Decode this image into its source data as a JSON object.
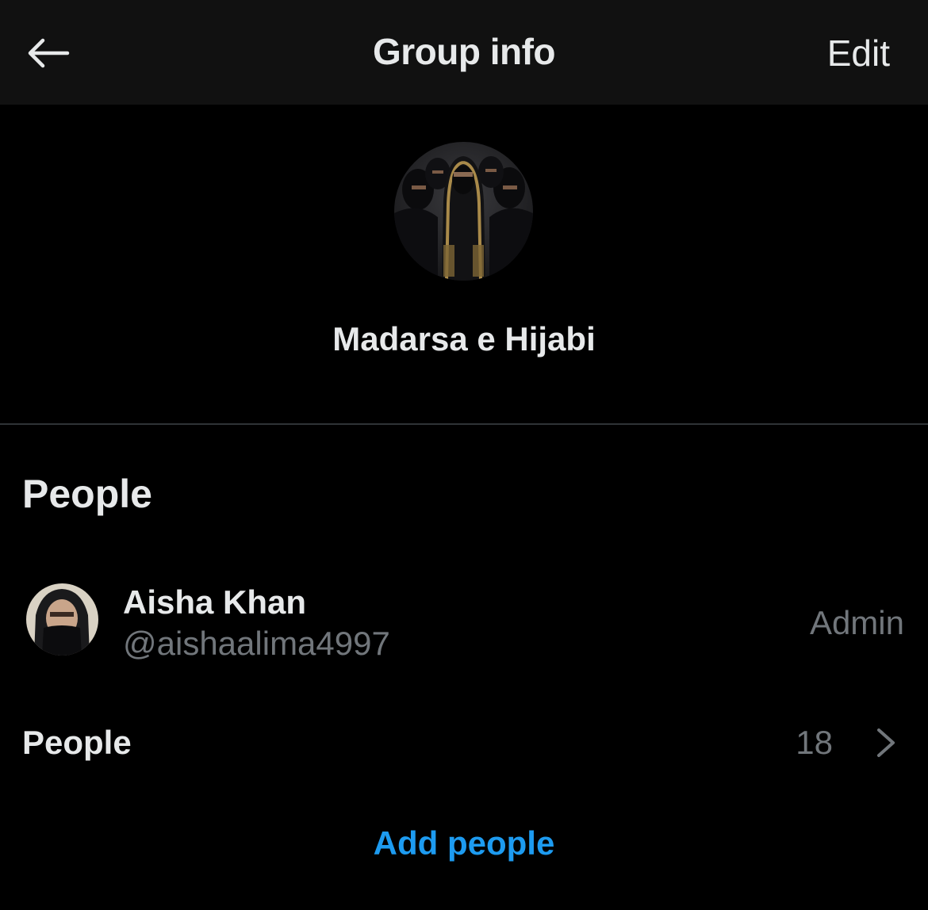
{
  "header": {
    "back_icon": "arrow-left-icon",
    "title": "Group info",
    "edit_label": "Edit"
  },
  "group": {
    "avatar": "group-photo",
    "name": "Madarsa e Hijabi"
  },
  "people_section": {
    "heading": "People",
    "members": [
      {
        "avatar": "member-photo",
        "name": "Aisha Khan",
        "handle": "@aishaalima4997",
        "role": "Admin"
      }
    ],
    "people_row": {
      "label": "People",
      "count": "18",
      "chevron_icon": "chevron-right-icon"
    },
    "add_people_label": "Add people"
  },
  "colors": {
    "background": "#000000",
    "header_background": "#111111",
    "primary_text": "#e7e9ea",
    "secondary_text": "#71767b",
    "accent": "#1d9bf0",
    "divider": "#2f3336"
  }
}
